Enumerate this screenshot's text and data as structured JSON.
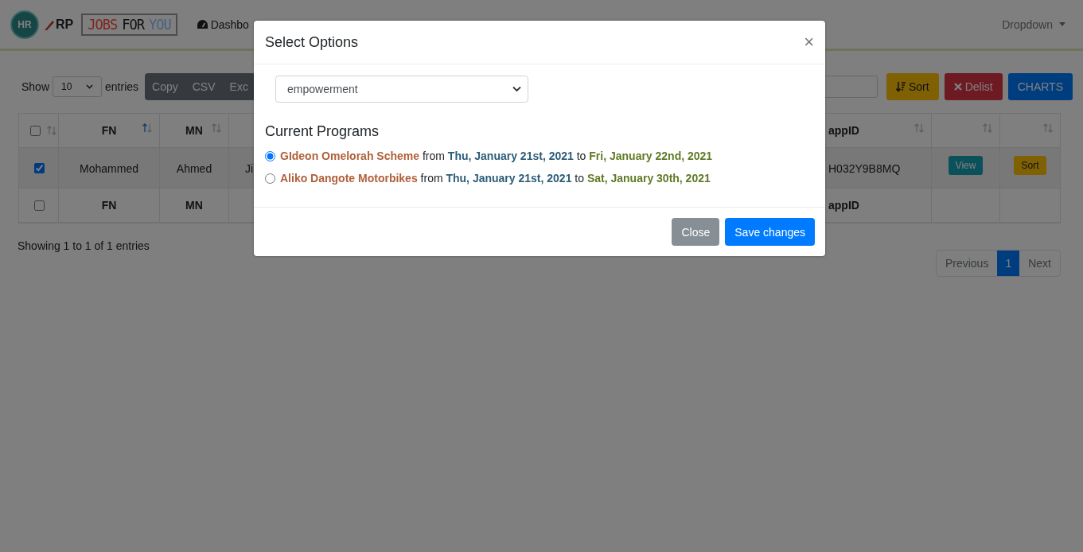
{
  "navbar": {
    "logo_badge": "HR",
    "logo_text": "RP",
    "brand_words": [
      "JOBS",
      "FOR",
      "YOU"
    ],
    "nav_items": [
      {
        "label": "Dashbo"
      }
    ],
    "dropdown": "Dropdown"
  },
  "toolbar": {
    "show_label": "Show",
    "page_size": "10",
    "entries_label": "entries",
    "export_buttons": [
      "Copy",
      "CSV",
      "Exc"
    ],
    "actions": [
      {
        "kind": "sort",
        "label": "Sort"
      },
      {
        "kind": "delist",
        "label": "Delist"
      },
      {
        "kind": "charts",
        "label": "CHARTS"
      }
    ]
  },
  "table": {
    "columns": [
      {
        "kind": "checkbox",
        "checked": false,
        "sorted": false
      },
      {
        "kind": "text",
        "label": "FN",
        "sorted": true
      },
      {
        "kind": "text",
        "label": "MN",
        "sorted": false
      },
      {
        "kind": "covered"
      },
      {
        "kind": "text",
        "label": "appID",
        "sorted": false
      },
      {
        "kind": "blank",
        "sorted": false
      },
      {
        "kind": "blank",
        "sorted": false
      }
    ],
    "rows": [
      {
        "cells": [
          {
            "kind": "checkbox",
            "checked": true
          },
          {
            "kind": "text",
            "text": "Mohammed"
          },
          {
            "kind": "text",
            "text": "Ahmed"
          },
          {
            "kind": "text",
            "text": "Ji"
          },
          {
            "kind": "text",
            "text": "H032Y9B8MQ"
          },
          {
            "kind": "button",
            "text": "View"
          },
          {
            "kind": "button",
            "text": "Sort"
          }
        ]
      }
    ],
    "footer": [
      {
        "kind": "checkbox",
        "checked": false
      },
      {
        "kind": "text",
        "label": "FN"
      },
      {
        "kind": "text",
        "label": "MN"
      },
      {
        "kind": "covered"
      },
      {
        "kind": "text",
        "label": "appID"
      },
      {
        "kind": "blank"
      },
      {
        "kind": "blank"
      }
    ]
  },
  "info": "Showing 1 to 1 of 1 entries",
  "pagination": [
    {
      "label": "Previous",
      "selected": false
    },
    {
      "label": "1",
      "selected": true
    },
    {
      "label": "Next",
      "selected": false
    }
  ],
  "modal": {
    "title": "Select Options",
    "close_glyph": "×",
    "select_value": "empowerment",
    "section_title": "Current Programs",
    "programs": [
      {
        "selected": true,
        "name": "GIdeon Omelorah Scheme",
        "from_word": "from",
        "start": "Thu, January 21st, 2021",
        "to_word": "to",
        "end": "Fri, January 22nd, 2021"
      },
      {
        "selected": false,
        "name": "Aliko Dangote Motorbikes",
        "from_word": "from",
        "start": "Thu, January 21st, 2021",
        "to_word": "to",
        "end": "Sat, January 30th, 2021"
      }
    ],
    "buttons": [
      {
        "kind": "secondary",
        "label": "Close"
      },
      {
        "kind": "primary",
        "label": "Save changes"
      }
    ]
  }
}
